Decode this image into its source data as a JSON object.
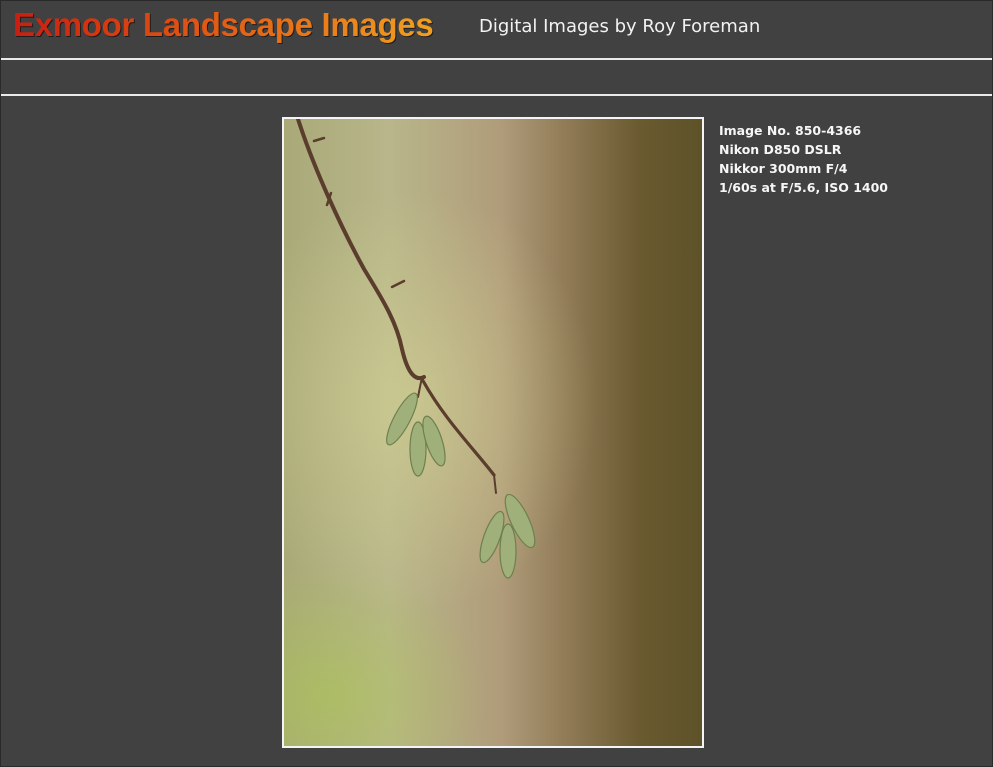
{
  "header": {
    "title": "Exmoor Landscape Images",
    "subtitle": "Digital Images by Roy Foreman"
  },
  "photo": {
    "subject": "hazel catkins on a twig"
  },
  "image_info": {
    "image_no": "Image No. 850-4366",
    "camera": "Nikon D850 DSLR",
    "lens": "Nikkor 300mm F/4",
    "exposure": "1/60s at F/5.6,  ISO 1400"
  },
  "colors": {
    "background": "#414141",
    "rule": "#e9e9e9",
    "title_start": "#c81e12",
    "title_end": "#f0a020",
    "text": "#f2f2f2"
  }
}
